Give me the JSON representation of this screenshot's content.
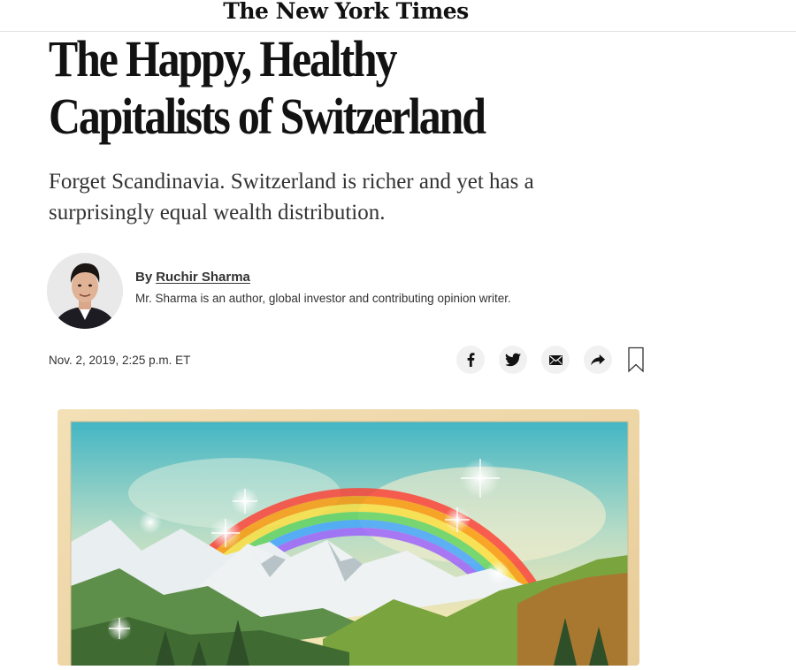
{
  "masthead": {
    "logo_text": "The New York Times"
  },
  "article": {
    "headline": "The Happy, Healthy\nCapitalists of Switzerland",
    "summary": "Forget Scandinavia. Switzerland is richer and yet has a surprisingly equal wealth distribution.",
    "byline_prefix": "By",
    "author_name": "Ruchir Sharma",
    "author_bio": "Mr. Sharma is an author, global investor and contributing opinion writer.",
    "date": "Nov. 2, 2019, 2:25 p.m. ET"
  },
  "share": {
    "icons": [
      "facebook-icon",
      "twitter-icon",
      "email-icon",
      "share-arrow-icon",
      "bookmark-icon"
    ],
    "icon_bg": "#f1f1f1"
  },
  "colors": {
    "text": "#121212",
    "summary": "#333333",
    "rule": "#e2e2e2"
  }
}
